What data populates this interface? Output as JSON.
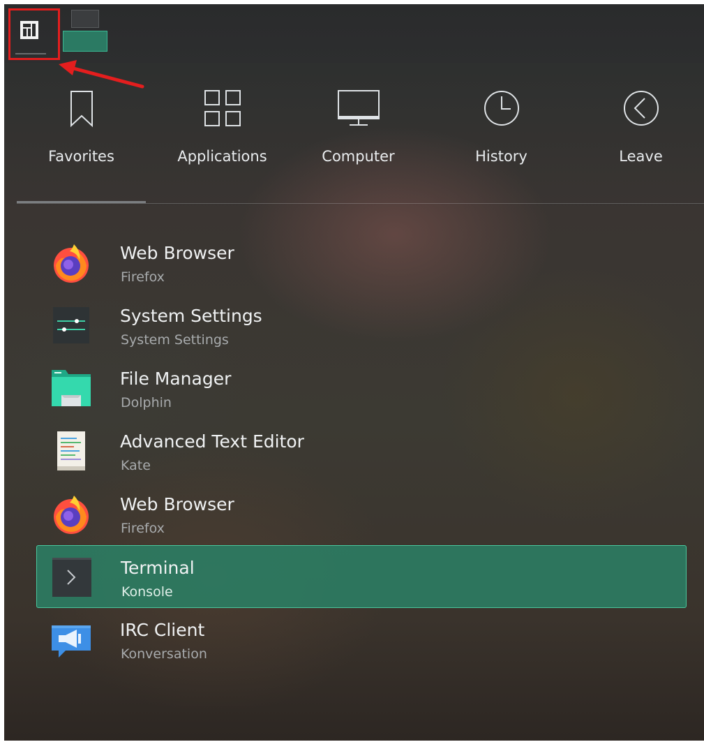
{
  "panel": {
    "launcher_icon": "manjaro-logo-icon",
    "pager_icon": "virtual-desktop-pager-icon"
  },
  "tabs": [
    {
      "label": "Favorites",
      "icon": "bookmark-icon"
    },
    {
      "label": "Applications",
      "icon": "grid-icon"
    },
    {
      "label": "Computer",
      "icon": "monitor-icon"
    },
    {
      "label": "History",
      "icon": "clock-icon"
    },
    {
      "label": "Leave",
      "icon": "chevron-left-circle-icon"
    }
  ],
  "favorites": [
    {
      "title": "Web Browser",
      "subtitle": "Firefox",
      "icon": "firefox-icon"
    },
    {
      "title": "System Settings",
      "subtitle": "System Settings",
      "icon": "settings-sliders-icon"
    },
    {
      "title": "File Manager",
      "subtitle": "Dolphin",
      "icon": "folder-icon"
    },
    {
      "title": "Advanced Text Editor",
      "subtitle": "Kate",
      "icon": "text-editor-icon"
    },
    {
      "title": "Web Browser",
      "subtitle": "Firefox",
      "icon": "firefox-icon"
    },
    {
      "title": "Terminal",
      "subtitle": "Konsole",
      "icon": "terminal-icon",
      "selected": true
    },
    {
      "title": "IRC Client",
      "subtitle": "Konversation",
      "icon": "chat-megaphone-icon"
    }
  ],
  "colors": {
    "accent": "#2b7e64",
    "accent_border": "#49c79d",
    "annotation": "#e41e1e"
  }
}
